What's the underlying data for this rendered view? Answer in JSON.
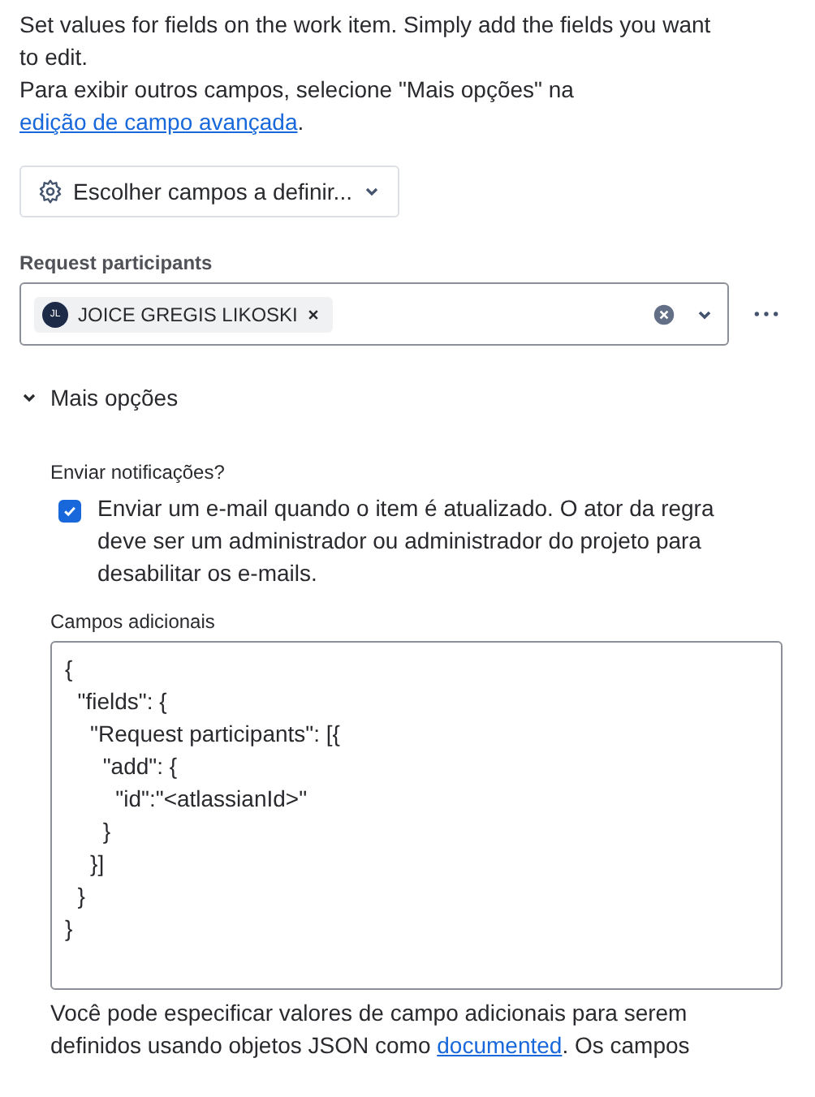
{
  "intro": {
    "text": "Set values for fields on the work item. Simply add the fields you want to edit.",
    "hint": "Para exibir outros campos, selecione \"Mais opções\" na ",
    "link": "edição de campo avançada",
    "after": "."
  },
  "choose_button": {
    "label": "Escolher campos a definir..."
  },
  "participants": {
    "label": "Request participants",
    "tags": [
      {
        "initials": "JL",
        "name": "JOICE GREGIS LIKOSKI"
      }
    ]
  },
  "more_options": {
    "label": "Mais opções",
    "expanded": true,
    "notify": {
      "label": "Enviar notificações?",
      "checked": true,
      "text": "Enviar um e-mail quando o item é atualizado. O ator da regra deve ser um administrador ou administrador do projeto para desabilitar os e-mails."
    },
    "additional": {
      "label": "Campos adicionais",
      "value": "{\n  \"fields\": {\n    \"Request participants\": [{\n      \"add\": {\n        \"id\":\"<atlassianId>\"\n      }\n    }]\n  }\n}"
    },
    "help": {
      "text": "Você pode especificar valores de campo adicionais para serem definidos usando objetos JSON como ",
      "link": "documented",
      "after": ". Os campos"
    }
  }
}
